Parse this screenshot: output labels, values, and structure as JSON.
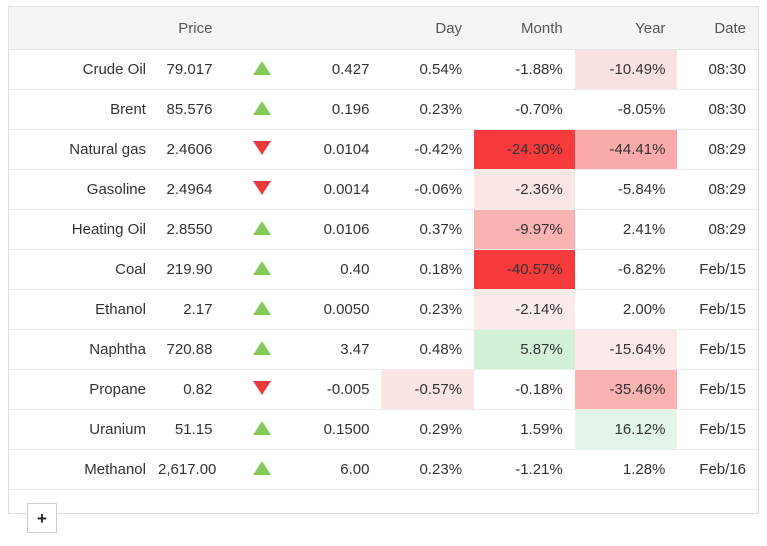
{
  "table": {
    "columns": [
      {
        "key": "name",
        "label": ""
      },
      {
        "key": "price",
        "label": "Price"
      },
      {
        "key": "arrow",
        "label": ""
      },
      {
        "key": "change",
        "label": ""
      },
      {
        "key": "day",
        "label": "Day"
      },
      {
        "key": "month",
        "label": "Month"
      },
      {
        "key": "year",
        "label": "Year"
      },
      {
        "key": "date",
        "label": "Date"
      }
    ],
    "rows": [
      {
        "name": "Crude Oil",
        "price": "79.017",
        "direction": "up",
        "change": "0.427",
        "day": "0.54%",
        "month": "-1.88%",
        "year": "-10.49%",
        "date": "08:30",
        "change_tone": "up",
        "day_tone": "up",
        "day_bg": "",
        "month_bg": "",
        "year_bg": "#fbe2e2"
      },
      {
        "name": "Brent",
        "price": "85.576",
        "direction": "up",
        "change": "0.196",
        "day": "0.23%",
        "month": "-0.70%",
        "year": "-8.05%",
        "date": "08:30",
        "change_tone": "up",
        "day_tone": "up",
        "day_bg": "",
        "month_bg": "",
        "year_bg": ""
      },
      {
        "name": "Natural gas",
        "price": "2.4606",
        "direction": "down",
        "change": "0.0104",
        "day": "-0.42%",
        "month": "-24.30%",
        "year": "-44.41%",
        "date": "08:29",
        "change_tone": "down",
        "day_tone": "down",
        "day_bg": "",
        "month_bg": "#f73a3c",
        "year_bg": "#f9aaaa"
      },
      {
        "name": "Gasoline",
        "price": "2.4964",
        "direction": "down",
        "change": "0.0014",
        "day": "-0.06%",
        "month": "-2.36%",
        "year": "-5.84%",
        "date": "08:29",
        "change_tone": "down",
        "day_tone": "down",
        "day_bg": "",
        "month_bg": "#fce7e7",
        "year_bg": ""
      },
      {
        "name": "Heating Oil",
        "price": "2.8550",
        "direction": "up",
        "change": "0.0106",
        "day": "0.37%",
        "month": "-9.97%",
        "year": "2.41%",
        "date": "08:29",
        "change_tone": "up",
        "day_tone": "up",
        "day_bg": "",
        "month_bg": "#f9b2b2",
        "year_bg": ""
      },
      {
        "name": "Coal",
        "price": "219.90",
        "direction": "up",
        "change": "0.40",
        "day": "0.18%",
        "month": "-40.57%",
        "year": "-6.82%",
        "date": "Feb/15",
        "change_tone": "flat",
        "day_tone": "flat",
        "day_bg": "",
        "month_bg": "#f73a3c",
        "year_bg": ""
      },
      {
        "name": "Ethanol",
        "price": "2.17",
        "direction": "up",
        "change": "0.0050",
        "day": "0.23%",
        "month": "-2.14%",
        "year": "2.00%",
        "date": "Feb/15",
        "change_tone": "flat",
        "day_tone": "flat",
        "day_bg": "",
        "month_bg": "#fcebeb",
        "year_bg": ""
      },
      {
        "name": "Naphtha",
        "price": "720.88",
        "direction": "up",
        "change": "3.47",
        "day": "0.48%",
        "month": "5.87%",
        "year": "-15.64%",
        "date": "Feb/15",
        "change_tone": "flat",
        "day_tone": "flat",
        "day_bg": "",
        "month_bg": "#d3f0d9",
        "year_bg": "#fceaea"
      },
      {
        "name": "Propane",
        "price": "0.82",
        "direction": "down",
        "change": "-0.005",
        "day": "-0.57%",
        "month": "-0.18%",
        "year": "-35.46%",
        "date": "Feb/15",
        "change_tone": "flat",
        "day_tone": "flat",
        "day_bg": "#fbe4e4",
        "month_bg": "",
        "year_bg": "#f9b2b2"
      },
      {
        "name": "Uranium",
        "price": "51.15",
        "direction": "up",
        "change": "0.1500",
        "day": "0.29%",
        "month": "1.59%",
        "year": "16.12%",
        "date": "Feb/15",
        "change_tone": "flat",
        "day_tone": "flat",
        "day_bg": "",
        "month_bg": "",
        "year_bg": "#e3f5e8"
      },
      {
        "name": "Methanol",
        "price": "2,617.00",
        "direction": "up",
        "change": "6.00",
        "day": "0.23%",
        "month": "-1.21%",
        "year": "1.28%",
        "date": "Feb/16",
        "change_tone": "flat",
        "day_tone": "flat",
        "day_bg": "",
        "month_bg": "",
        "year_bg": ""
      }
    ],
    "add_button_label": "+"
  },
  "colors": {
    "up_arrow": "#85cb57",
    "down_arrow": "#ea3a3b",
    "up_text": "#2f7a33",
    "down_text": "#9c2a2a",
    "neutral_text": "#3b4148",
    "header_bg": "#f5f5f5",
    "border": "#ededed"
  }
}
